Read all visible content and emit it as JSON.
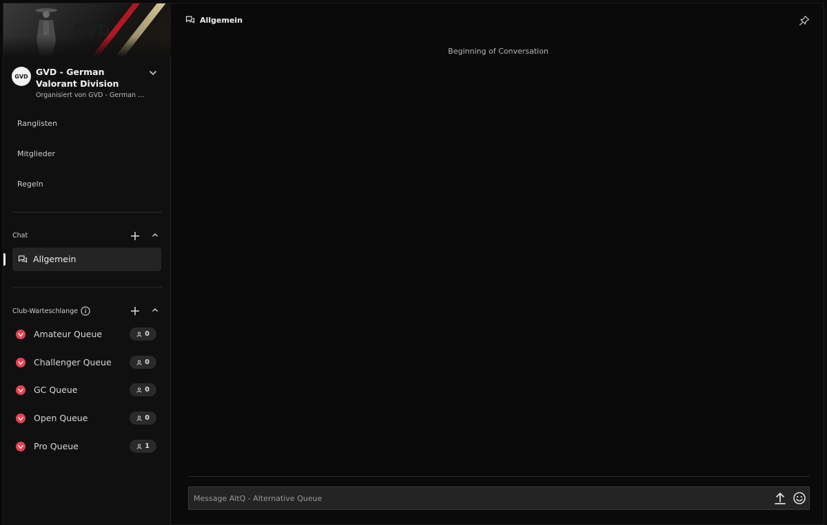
{
  "club": {
    "avatar_text": "GVD",
    "banner_text": "GVD",
    "name": "GVD - German Valorant Division",
    "subtitle": "Organisiert von GVD - German Valorant Division"
  },
  "nav": [
    {
      "label": "Ranglisten"
    },
    {
      "label": "Mitglieder"
    },
    {
      "label": "Regeln"
    }
  ],
  "chat_section": {
    "label": "Chat",
    "channels": [
      {
        "label": "Allgemein",
        "active": true
      }
    ]
  },
  "queue_section": {
    "label": "Club-Warteschlange",
    "queues": [
      {
        "label": "Amateur Queue",
        "count": "0"
      },
      {
        "label": "Challenger Queue",
        "count": "0"
      },
      {
        "label": "GC Queue",
        "count": "0"
      },
      {
        "label": "Open Queue",
        "count": "0"
      },
      {
        "label": "Pro Queue",
        "count": "1"
      }
    ]
  },
  "main": {
    "channel_title": "Allgemein",
    "beginning_text": "Beginning of Conversation",
    "composer_placeholder": "Message AltQ - Alternative Queue"
  },
  "colors": {
    "accent_red": "#e8414f",
    "background": "#0a0a0a",
    "sidebar": "#101010"
  }
}
